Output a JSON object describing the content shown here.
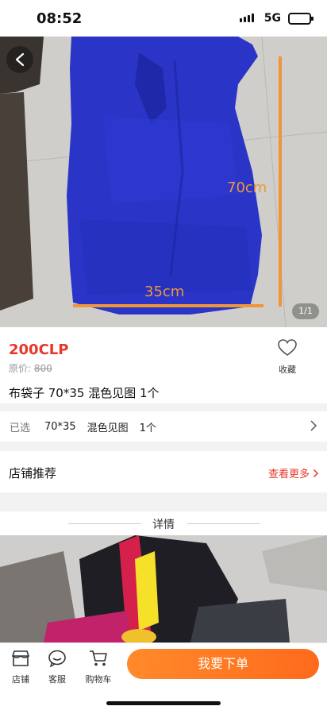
{
  "status_bar": {
    "time": "08:52",
    "network": "5G"
  },
  "hero": {
    "measure_height": "70cm",
    "measure_width": "35cm",
    "image_counter": "1/1"
  },
  "product": {
    "price": "200CLP",
    "original_price_label": "原价:",
    "original_price_value": "800",
    "favorite_label": "收藏",
    "title": "布袋子 70*35 混色见图 1个"
  },
  "spec": {
    "label": "已选",
    "values": [
      "70*35",
      "混色见图",
      "1个"
    ]
  },
  "shop_recommend": {
    "title": "店铺推荐",
    "more": "查看更多"
  },
  "details": {
    "heading": "详情"
  },
  "bottom_bar": {
    "tabs": [
      {
        "label": "店铺",
        "icon": "store-icon"
      },
      {
        "label": "客服",
        "icon": "chat-icon"
      },
      {
        "label": "购物车",
        "icon": "cart-icon"
      }
    ],
    "buy_label": "我要下单"
  },
  "colors": {
    "accent": "#e8362a",
    "buy_button": "#ff7a22",
    "measure_lines": "#f0963a",
    "bag_blue": "#2531c4"
  }
}
